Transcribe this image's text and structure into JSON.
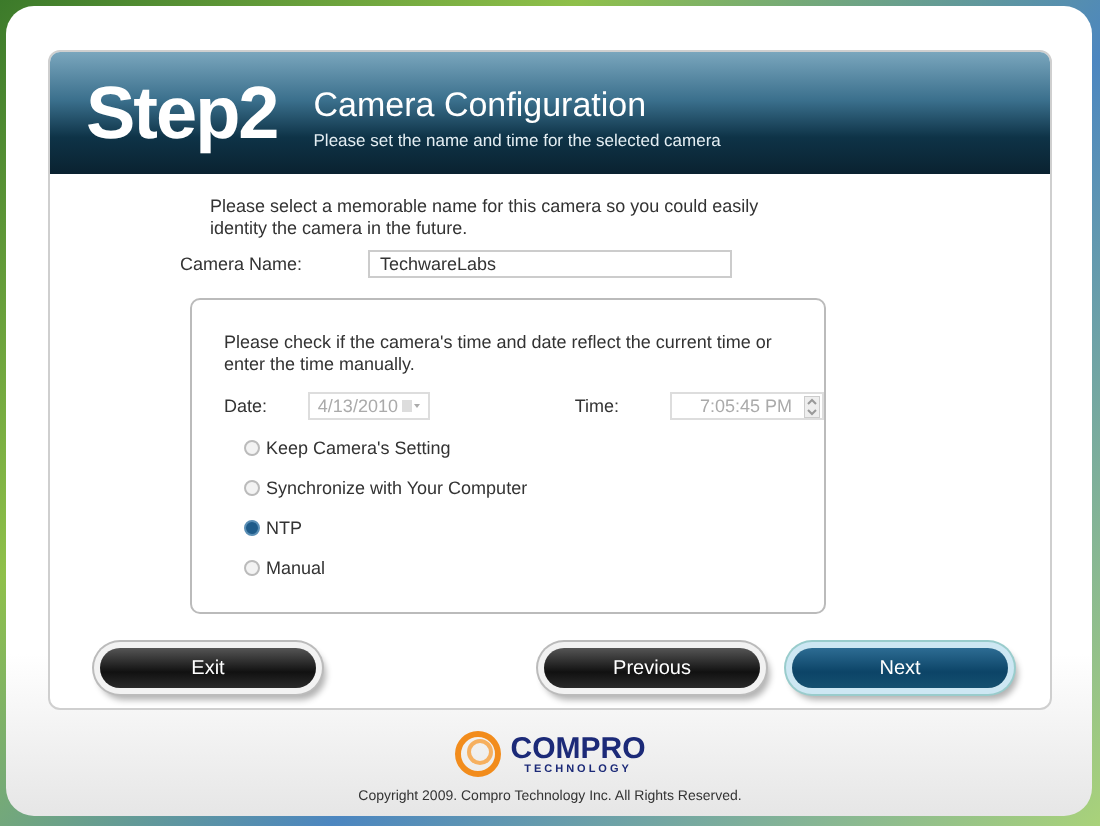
{
  "header": {
    "step": "Step2",
    "title": "Camera Configuration",
    "subtitle": "Please set the name and time for the selected camera"
  },
  "intro": "Please select a memorable name for this camera so you could easily identity the camera in the future.",
  "camera_name": {
    "label": "Camera Name:",
    "value": "TechwareLabs"
  },
  "time_box": {
    "instructions": "Please check if the camera's time and date reflect the current time or enter the time manually.",
    "date": {
      "label": "Date:",
      "value": "4/13/2010",
      "disabled": true
    },
    "time": {
      "label": "Time:",
      "value": "7:05:45 PM",
      "disabled": true
    },
    "options": [
      {
        "label": "Keep Camera's Setting",
        "selected": false
      },
      {
        "label": "Synchronize with Your Computer",
        "selected": false
      },
      {
        "label": "NTP",
        "selected": true
      },
      {
        "label": "Manual",
        "selected": false
      }
    ]
  },
  "buttons": [
    {
      "label": "Exit",
      "highlighted": false
    },
    {
      "label": "Previous",
      "highlighted": false
    },
    {
      "label": "Next",
      "highlighted": true
    }
  ],
  "logo": {
    "name": "COMPRO",
    "tagline": "TECHNOLOGY"
  },
  "copyright": "Copyright 2009. Compro Technology Inc. All Rights Reserved."
}
